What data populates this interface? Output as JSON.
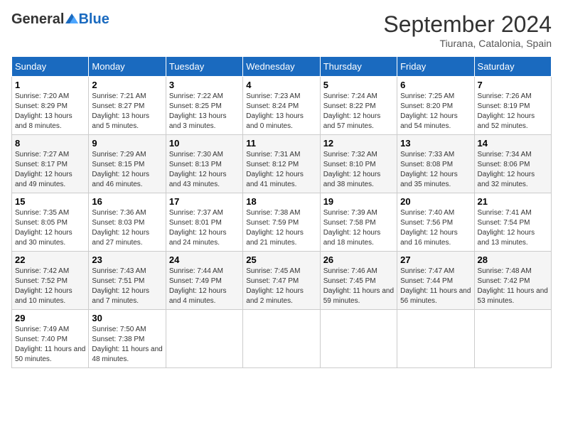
{
  "header": {
    "logo_general": "General",
    "logo_blue": "Blue",
    "title": "September 2024",
    "location": "Tiurana, Catalonia, Spain"
  },
  "weekdays": [
    "Sunday",
    "Monday",
    "Tuesday",
    "Wednesday",
    "Thursday",
    "Friday",
    "Saturday"
  ],
  "weeks": [
    [
      {
        "day": "1",
        "sunrise": "Sunrise: 7:20 AM",
        "sunset": "Sunset: 8:29 PM",
        "daylight": "Daylight: 13 hours and 8 minutes."
      },
      {
        "day": "2",
        "sunrise": "Sunrise: 7:21 AM",
        "sunset": "Sunset: 8:27 PM",
        "daylight": "Daylight: 13 hours and 5 minutes."
      },
      {
        "day": "3",
        "sunrise": "Sunrise: 7:22 AM",
        "sunset": "Sunset: 8:25 PM",
        "daylight": "Daylight: 13 hours and 3 minutes."
      },
      {
        "day": "4",
        "sunrise": "Sunrise: 7:23 AM",
        "sunset": "Sunset: 8:24 PM",
        "daylight": "Daylight: 13 hours and 0 minutes."
      },
      {
        "day": "5",
        "sunrise": "Sunrise: 7:24 AM",
        "sunset": "Sunset: 8:22 PM",
        "daylight": "Daylight: 12 hours and 57 minutes."
      },
      {
        "day": "6",
        "sunrise": "Sunrise: 7:25 AM",
        "sunset": "Sunset: 8:20 PM",
        "daylight": "Daylight: 12 hours and 54 minutes."
      },
      {
        "day": "7",
        "sunrise": "Sunrise: 7:26 AM",
        "sunset": "Sunset: 8:19 PM",
        "daylight": "Daylight: 12 hours and 52 minutes."
      }
    ],
    [
      {
        "day": "8",
        "sunrise": "Sunrise: 7:27 AM",
        "sunset": "Sunset: 8:17 PM",
        "daylight": "Daylight: 12 hours and 49 minutes."
      },
      {
        "day": "9",
        "sunrise": "Sunrise: 7:29 AM",
        "sunset": "Sunset: 8:15 PM",
        "daylight": "Daylight: 12 hours and 46 minutes."
      },
      {
        "day": "10",
        "sunrise": "Sunrise: 7:30 AM",
        "sunset": "Sunset: 8:13 PM",
        "daylight": "Daylight: 12 hours and 43 minutes."
      },
      {
        "day": "11",
        "sunrise": "Sunrise: 7:31 AM",
        "sunset": "Sunset: 8:12 PM",
        "daylight": "Daylight: 12 hours and 41 minutes."
      },
      {
        "day": "12",
        "sunrise": "Sunrise: 7:32 AM",
        "sunset": "Sunset: 8:10 PM",
        "daylight": "Daylight: 12 hours and 38 minutes."
      },
      {
        "day": "13",
        "sunrise": "Sunrise: 7:33 AM",
        "sunset": "Sunset: 8:08 PM",
        "daylight": "Daylight: 12 hours and 35 minutes."
      },
      {
        "day": "14",
        "sunrise": "Sunrise: 7:34 AM",
        "sunset": "Sunset: 8:06 PM",
        "daylight": "Daylight: 12 hours and 32 minutes."
      }
    ],
    [
      {
        "day": "15",
        "sunrise": "Sunrise: 7:35 AM",
        "sunset": "Sunset: 8:05 PM",
        "daylight": "Daylight: 12 hours and 30 minutes."
      },
      {
        "day": "16",
        "sunrise": "Sunrise: 7:36 AM",
        "sunset": "Sunset: 8:03 PM",
        "daylight": "Daylight: 12 hours and 27 minutes."
      },
      {
        "day": "17",
        "sunrise": "Sunrise: 7:37 AM",
        "sunset": "Sunset: 8:01 PM",
        "daylight": "Daylight: 12 hours and 24 minutes."
      },
      {
        "day": "18",
        "sunrise": "Sunrise: 7:38 AM",
        "sunset": "Sunset: 7:59 PM",
        "daylight": "Daylight: 12 hours and 21 minutes."
      },
      {
        "day": "19",
        "sunrise": "Sunrise: 7:39 AM",
        "sunset": "Sunset: 7:58 PM",
        "daylight": "Daylight: 12 hours and 18 minutes."
      },
      {
        "day": "20",
        "sunrise": "Sunrise: 7:40 AM",
        "sunset": "Sunset: 7:56 PM",
        "daylight": "Daylight: 12 hours and 16 minutes."
      },
      {
        "day": "21",
        "sunrise": "Sunrise: 7:41 AM",
        "sunset": "Sunset: 7:54 PM",
        "daylight": "Daylight: 12 hours and 13 minutes."
      }
    ],
    [
      {
        "day": "22",
        "sunrise": "Sunrise: 7:42 AM",
        "sunset": "Sunset: 7:52 PM",
        "daylight": "Daylight: 12 hours and 10 minutes."
      },
      {
        "day": "23",
        "sunrise": "Sunrise: 7:43 AM",
        "sunset": "Sunset: 7:51 PM",
        "daylight": "Daylight: 12 hours and 7 minutes."
      },
      {
        "day": "24",
        "sunrise": "Sunrise: 7:44 AM",
        "sunset": "Sunset: 7:49 PM",
        "daylight": "Daylight: 12 hours and 4 minutes."
      },
      {
        "day": "25",
        "sunrise": "Sunrise: 7:45 AM",
        "sunset": "Sunset: 7:47 PM",
        "daylight": "Daylight: 12 hours and 2 minutes."
      },
      {
        "day": "26",
        "sunrise": "Sunrise: 7:46 AM",
        "sunset": "Sunset: 7:45 PM",
        "daylight": "Daylight: 11 hours and 59 minutes."
      },
      {
        "day": "27",
        "sunrise": "Sunrise: 7:47 AM",
        "sunset": "Sunset: 7:44 PM",
        "daylight": "Daylight: 11 hours and 56 minutes."
      },
      {
        "day": "28",
        "sunrise": "Sunrise: 7:48 AM",
        "sunset": "Sunset: 7:42 PM",
        "daylight": "Daylight: 11 hours and 53 minutes."
      }
    ],
    [
      {
        "day": "29",
        "sunrise": "Sunrise: 7:49 AM",
        "sunset": "Sunset: 7:40 PM",
        "daylight": "Daylight: 11 hours and 50 minutes."
      },
      {
        "day": "30",
        "sunrise": "Sunrise: 7:50 AM",
        "sunset": "Sunset: 7:38 PM",
        "daylight": "Daylight: 11 hours and 48 minutes."
      },
      null,
      null,
      null,
      null,
      null
    ]
  ]
}
